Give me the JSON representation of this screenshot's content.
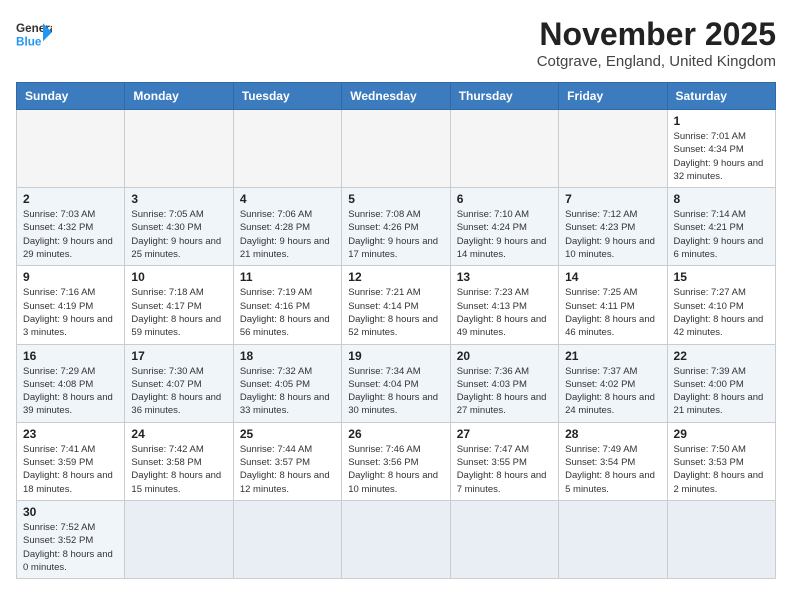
{
  "header": {
    "logo_line1": "General",
    "logo_line2": "Blue",
    "month_title": "November 2025",
    "location": "Cotgrave, England, United Kingdom"
  },
  "weekdays": [
    "Sunday",
    "Monday",
    "Tuesday",
    "Wednesday",
    "Thursday",
    "Friday",
    "Saturday"
  ],
  "weeks": [
    [
      {
        "day": "",
        "info": ""
      },
      {
        "day": "",
        "info": ""
      },
      {
        "day": "",
        "info": ""
      },
      {
        "day": "",
        "info": ""
      },
      {
        "day": "",
        "info": ""
      },
      {
        "day": "",
        "info": ""
      },
      {
        "day": "1",
        "info": "Sunrise: 7:01 AM\nSunset: 4:34 PM\nDaylight: 9 hours\nand 32 minutes."
      }
    ],
    [
      {
        "day": "2",
        "info": "Sunrise: 7:03 AM\nSunset: 4:32 PM\nDaylight: 9 hours\nand 29 minutes."
      },
      {
        "day": "3",
        "info": "Sunrise: 7:05 AM\nSunset: 4:30 PM\nDaylight: 9 hours\nand 25 minutes."
      },
      {
        "day": "4",
        "info": "Sunrise: 7:06 AM\nSunset: 4:28 PM\nDaylight: 9 hours\nand 21 minutes."
      },
      {
        "day": "5",
        "info": "Sunrise: 7:08 AM\nSunset: 4:26 PM\nDaylight: 9 hours\nand 17 minutes."
      },
      {
        "day": "6",
        "info": "Sunrise: 7:10 AM\nSunset: 4:24 PM\nDaylight: 9 hours\nand 14 minutes."
      },
      {
        "day": "7",
        "info": "Sunrise: 7:12 AM\nSunset: 4:23 PM\nDaylight: 9 hours\nand 10 minutes."
      },
      {
        "day": "8",
        "info": "Sunrise: 7:14 AM\nSunset: 4:21 PM\nDaylight: 9 hours\nand 6 minutes."
      }
    ],
    [
      {
        "day": "9",
        "info": "Sunrise: 7:16 AM\nSunset: 4:19 PM\nDaylight: 9 hours\nand 3 minutes."
      },
      {
        "day": "10",
        "info": "Sunrise: 7:18 AM\nSunset: 4:17 PM\nDaylight: 8 hours\nand 59 minutes."
      },
      {
        "day": "11",
        "info": "Sunrise: 7:19 AM\nSunset: 4:16 PM\nDaylight: 8 hours\nand 56 minutes."
      },
      {
        "day": "12",
        "info": "Sunrise: 7:21 AM\nSunset: 4:14 PM\nDaylight: 8 hours\nand 52 minutes."
      },
      {
        "day": "13",
        "info": "Sunrise: 7:23 AM\nSunset: 4:13 PM\nDaylight: 8 hours\nand 49 minutes."
      },
      {
        "day": "14",
        "info": "Sunrise: 7:25 AM\nSunset: 4:11 PM\nDaylight: 8 hours\nand 46 minutes."
      },
      {
        "day": "15",
        "info": "Sunrise: 7:27 AM\nSunset: 4:10 PM\nDaylight: 8 hours\nand 42 minutes."
      }
    ],
    [
      {
        "day": "16",
        "info": "Sunrise: 7:29 AM\nSunset: 4:08 PM\nDaylight: 8 hours\nand 39 minutes."
      },
      {
        "day": "17",
        "info": "Sunrise: 7:30 AM\nSunset: 4:07 PM\nDaylight: 8 hours\nand 36 minutes."
      },
      {
        "day": "18",
        "info": "Sunrise: 7:32 AM\nSunset: 4:05 PM\nDaylight: 8 hours\nand 33 minutes."
      },
      {
        "day": "19",
        "info": "Sunrise: 7:34 AM\nSunset: 4:04 PM\nDaylight: 8 hours\nand 30 minutes."
      },
      {
        "day": "20",
        "info": "Sunrise: 7:36 AM\nSunset: 4:03 PM\nDaylight: 8 hours\nand 27 minutes."
      },
      {
        "day": "21",
        "info": "Sunrise: 7:37 AM\nSunset: 4:02 PM\nDaylight: 8 hours\nand 24 minutes."
      },
      {
        "day": "22",
        "info": "Sunrise: 7:39 AM\nSunset: 4:00 PM\nDaylight: 8 hours\nand 21 minutes."
      }
    ],
    [
      {
        "day": "23",
        "info": "Sunrise: 7:41 AM\nSunset: 3:59 PM\nDaylight: 8 hours\nand 18 minutes."
      },
      {
        "day": "24",
        "info": "Sunrise: 7:42 AM\nSunset: 3:58 PM\nDaylight: 8 hours\nand 15 minutes."
      },
      {
        "day": "25",
        "info": "Sunrise: 7:44 AM\nSunset: 3:57 PM\nDaylight: 8 hours\nand 12 minutes."
      },
      {
        "day": "26",
        "info": "Sunrise: 7:46 AM\nSunset: 3:56 PM\nDaylight: 8 hours\nand 10 minutes."
      },
      {
        "day": "27",
        "info": "Sunrise: 7:47 AM\nSunset: 3:55 PM\nDaylight: 8 hours\nand 7 minutes."
      },
      {
        "day": "28",
        "info": "Sunrise: 7:49 AM\nSunset: 3:54 PM\nDaylight: 8 hours\nand 5 minutes."
      },
      {
        "day": "29",
        "info": "Sunrise: 7:50 AM\nSunset: 3:53 PM\nDaylight: 8 hours\nand 2 minutes."
      }
    ],
    [
      {
        "day": "30",
        "info": "Sunrise: 7:52 AM\nSunset: 3:52 PM\nDaylight: 8 hours\nand 0 minutes."
      },
      {
        "day": "",
        "info": ""
      },
      {
        "day": "",
        "info": ""
      },
      {
        "day": "",
        "info": ""
      },
      {
        "day": "",
        "info": ""
      },
      {
        "day": "",
        "info": ""
      },
      {
        "day": "",
        "info": ""
      }
    ]
  ]
}
